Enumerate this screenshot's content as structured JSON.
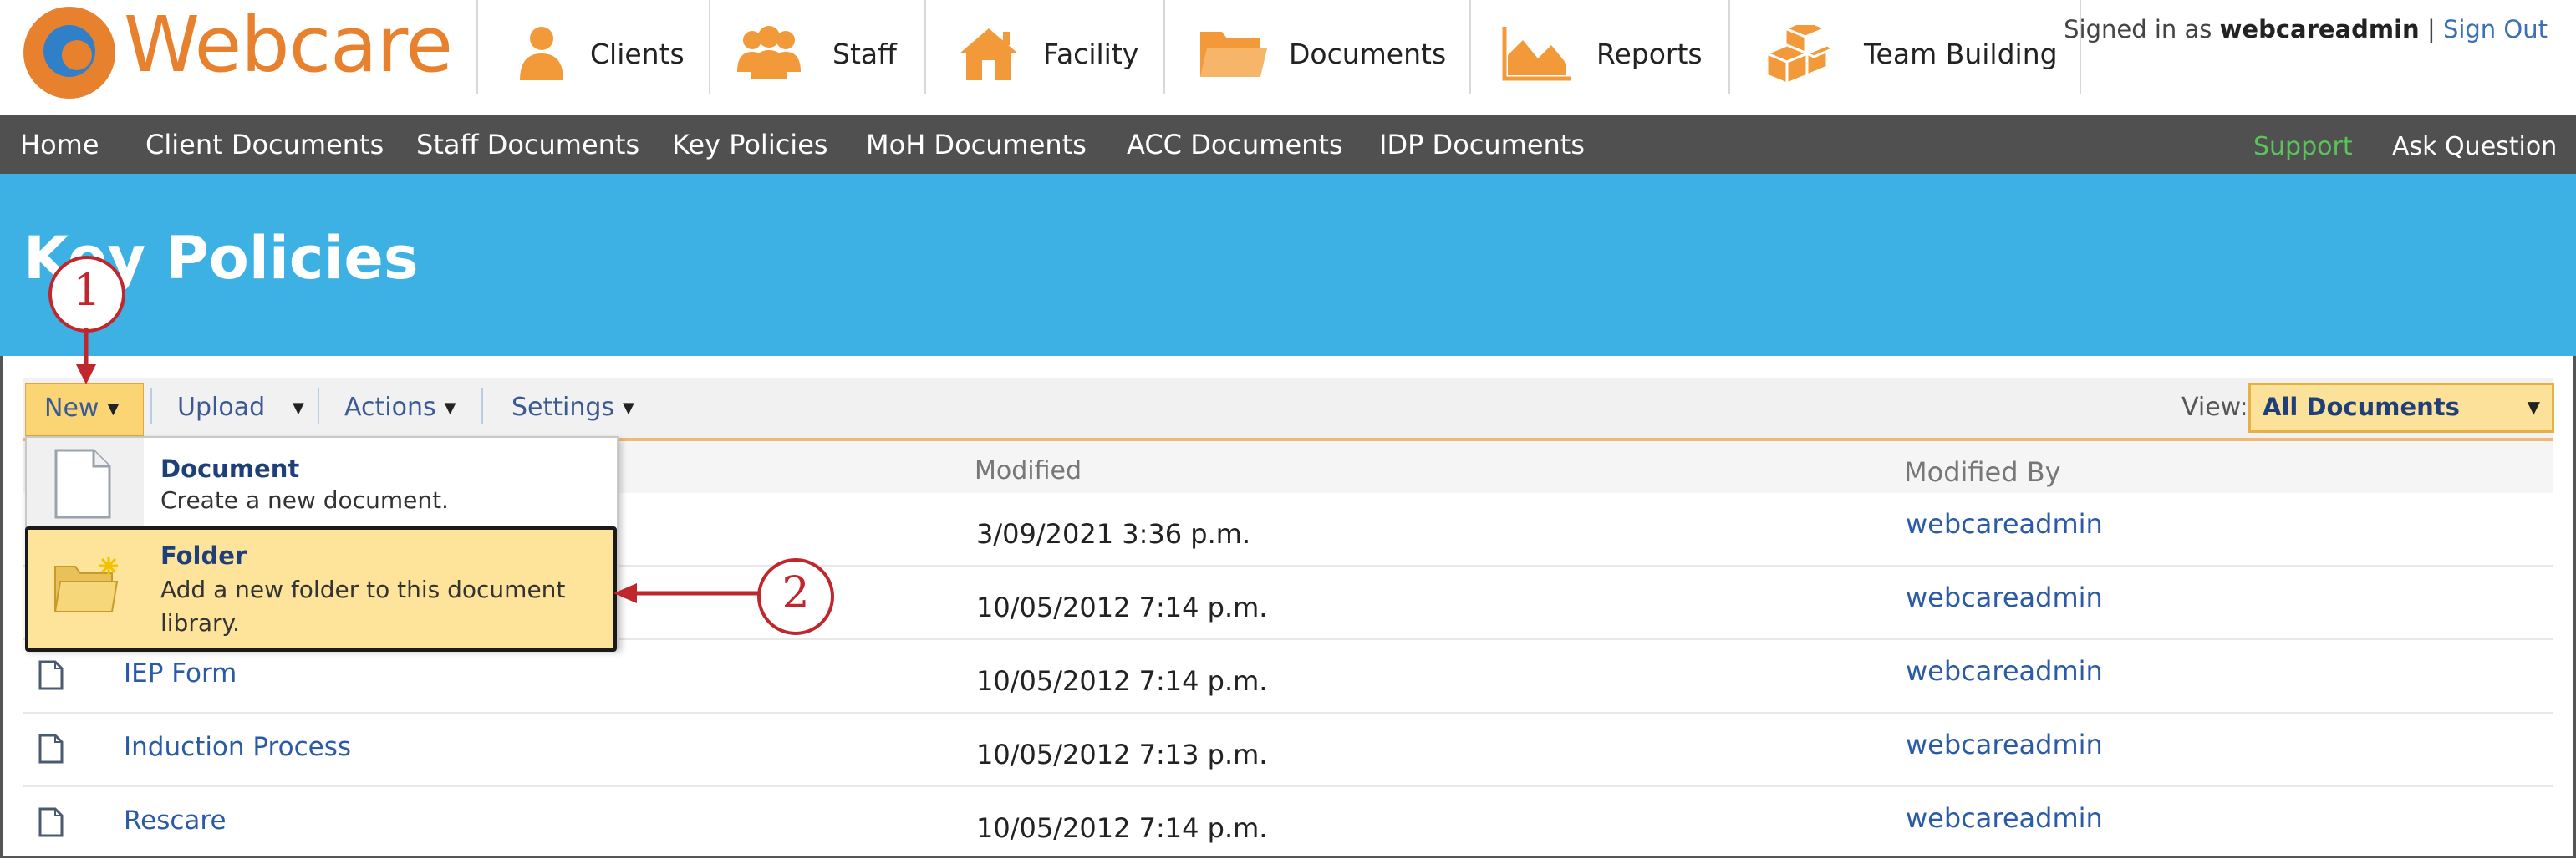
{
  "app": {
    "name": "Webcare"
  },
  "header": {
    "nav_tiles": [
      {
        "label": "Clients",
        "icon": "person-icon"
      },
      {
        "label": "Staff",
        "icon": "group-icon"
      },
      {
        "label": "Facility",
        "icon": "house-icon"
      },
      {
        "label": "Documents",
        "icon": "folder-icon"
      },
      {
        "label": "Reports",
        "icon": "chart-icon"
      },
      {
        "label": "Team Building",
        "icon": "blocks-icon"
      }
    ],
    "signed_in_prefix": "Signed in as",
    "user": "webcareadmin",
    "separator": "|",
    "sign_out": "Sign Out"
  },
  "navbar": {
    "items": [
      "Home",
      "Client Documents",
      "Staff Documents",
      "Key Policies",
      "MoH Documents",
      "ACC Documents",
      "IDP Documents"
    ],
    "support": "Support",
    "ask": "Ask Question"
  },
  "page": {
    "title": "Key Policies"
  },
  "toolbar": {
    "new": "New",
    "upload": "Upload",
    "actions": "Actions",
    "settings": "Settings",
    "view_label": "View:",
    "view_value": "All Documents"
  },
  "list": {
    "headers": {
      "modified": "Modified",
      "modified_by": "Modified By"
    },
    "rows": [
      {
        "name": "",
        "modified": "3/09/2021 3:36 p.m.",
        "modified_by": "webcareadmin"
      },
      {
        "name": "",
        "modified": "10/05/2012 7:14 p.m.",
        "modified_by": "webcareadmin"
      },
      {
        "name": "IEP Form",
        "modified": "10/05/2012 7:14 p.m.",
        "modified_by": "webcareadmin"
      },
      {
        "name": "Induction Process",
        "modified": "10/05/2012 7:13 p.m.",
        "modified_by": "webcareadmin"
      },
      {
        "name": "Rescare",
        "modified": "10/05/2012 7:14 p.m.",
        "modified_by": "webcareadmin"
      }
    ]
  },
  "new_menu": {
    "document": {
      "title": "Document",
      "desc": "Create a new document."
    },
    "folder": {
      "title": "Folder",
      "desc": "Add a new folder to this document library."
    }
  },
  "callouts": [
    "1",
    "2"
  ],
  "colors": {
    "accent_orange": "#e8812e",
    "banner_blue": "#3eb1e4",
    "nav_gray": "#505050",
    "callout_red": "#c0272d",
    "highlight_yellow": "#fde49a"
  }
}
